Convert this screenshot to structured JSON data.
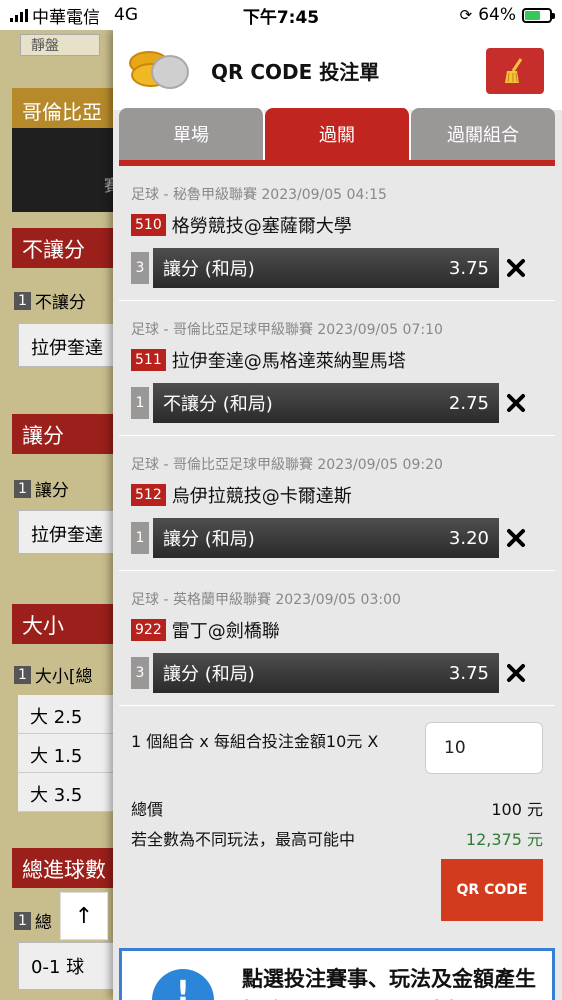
{
  "status_bar": {
    "carrier": "中華電信",
    "network": "4G",
    "time": "下午7:45",
    "battery": "64%",
    "battery_level": 0.64
  },
  "background": {
    "top_tab": "靜盤",
    "league_header": "哥倫比亞",
    "dark_text": "賽",
    "section1_title": "不讓分",
    "section1_num": "1",
    "section1_sub": "不讓分",
    "section1_option": "拉伊奎達",
    "section2_title": "讓分",
    "section2_num": "1",
    "section2_sub": "讓分",
    "section2_option": "拉伊奎達",
    "section3_title": "大小",
    "section3_num": "1",
    "section3_sub": "大小[總",
    "section3_options": [
      "大 2.5",
      "大 1.5",
      "大 3.5"
    ],
    "section4_title": "總進球數",
    "section4_num": "1",
    "section4_sub": "總",
    "section4_option": "0-1 球",
    "scroll_top_label": "↑"
  },
  "panel": {
    "title": "QR CODE 投注單",
    "tabs": [
      {
        "label": "單場",
        "active": false
      },
      {
        "label": "過關",
        "active": true
      },
      {
        "label": "過關組合",
        "active": false
      }
    ],
    "bets": [
      {
        "meta": "足球 - 秘魯甲級聯賽 2023/09/05 04:15",
        "code": "510",
        "match": "格勞競技@塞薩爾大學",
        "count": "3",
        "pick": "讓分 (和局)",
        "odds": "3.75"
      },
      {
        "meta": "足球 - 哥倫比亞足球甲級聯賽 2023/09/05 07:10",
        "code": "511",
        "match": "拉伊奎達@馬格達萊納聖馬塔",
        "count": "1",
        "pick": "不讓分 (和局)",
        "odds": "2.75"
      },
      {
        "meta": "足球 - 哥倫比亞足球甲級聯賽 2023/09/05 09:20",
        "code": "512",
        "match": "烏伊拉競技@卡爾達斯",
        "count": "1",
        "pick": "讓分 (和局)",
        "odds": "3.20"
      },
      {
        "meta": "足球 - 英格蘭甲級聯賽 2023/09/05 03:00",
        "code": "922",
        "match": "雷丁@劍橋聯",
        "count": "3",
        "pick": "讓分 (和局)",
        "odds": "3.75"
      }
    ],
    "combo_text": "1 個組合 x 每組合投注金額10元 X",
    "amount_value": "10",
    "total_label": "總價",
    "total_value": "100 元",
    "max_label": "若全數為不同玩法，最高可能中",
    "max_value": "12,375 元",
    "qr_button": "QR CODE",
    "info_text": "點選投注賽事、玩法及金額產生投注QR Code，可直接",
    "info_icon": "!"
  },
  "colors": {
    "accent_red": "#c0251f",
    "tab_gray": "#9a9797",
    "green": "#2e7d32",
    "info_blue": "#2b86d9"
  }
}
